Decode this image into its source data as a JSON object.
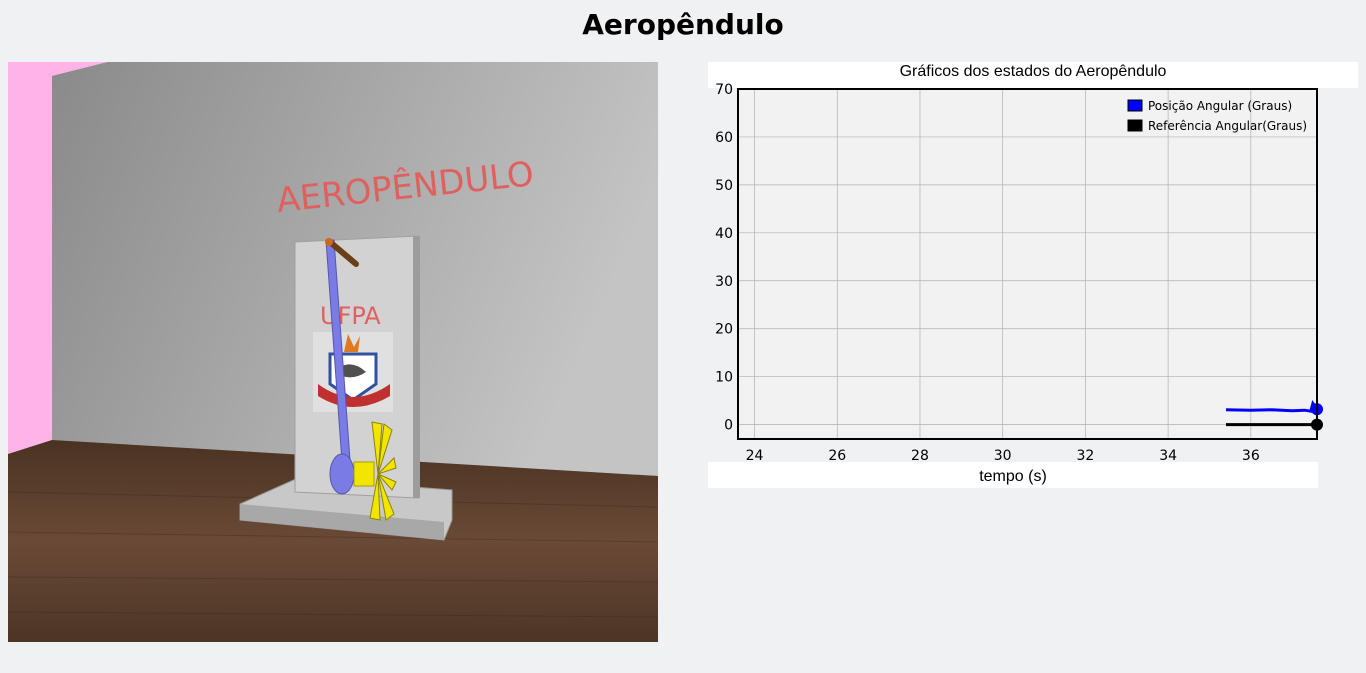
{
  "page": {
    "title": "Aeropêndulo"
  },
  "scene": {
    "wall_text": "AEROPÊNDULO",
    "panel_text": "UFPA",
    "colors": {
      "wall": "#a8a8a8",
      "floor": "#5a3f2e",
      "pink_wall": "#ffb3e6",
      "pendulum": "#7b7be6",
      "propeller": "#f2e600",
      "text": "#e06060"
    }
  },
  "chart": {
    "title": "Gráficos dos estados do Aeropêndulo",
    "xlabel": "tempo (s)"
  },
  "chart_data": {
    "type": "line",
    "title": "Gráficos dos estados do Aeropêndulo",
    "xlabel": "tempo (s)",
    "ylabel": "",
    "xlim": [
      23.6,
      37.6
    ],
    "ylim": [
      -3,
      70
    ],
    "xticks": [
      24,
      26,
      28,
      30,
      32,
      34,
      36
    ],
    "yticks": [
      0,
      10,
      20,
      30,
      40,
      50,
      60,
      70
    ],
    "grid": true,
    "legend": "top-right",
    "series": [
      {
        "name": "Posição Angular (Graus)",
        "color": "#0000ff",
        "x": [
          35.4,
          36.0,
          36.5,
          37.0,
          37.3,
          37.45,
          37.5,
          37.6
        ],
        "y": [
          3.1,
          3.0,
          3.1,
          2.9,
          3.0,
          2.8,
          4.4,
          3.2
        ]
      },
      {
        "name": "Referência Angular(Graus)",
        "color": "#000000",
        "x": [
          35.4,
          37.6
        ],
        "y": [
          0,
          0
        ]
      }
    ]
  }
}
